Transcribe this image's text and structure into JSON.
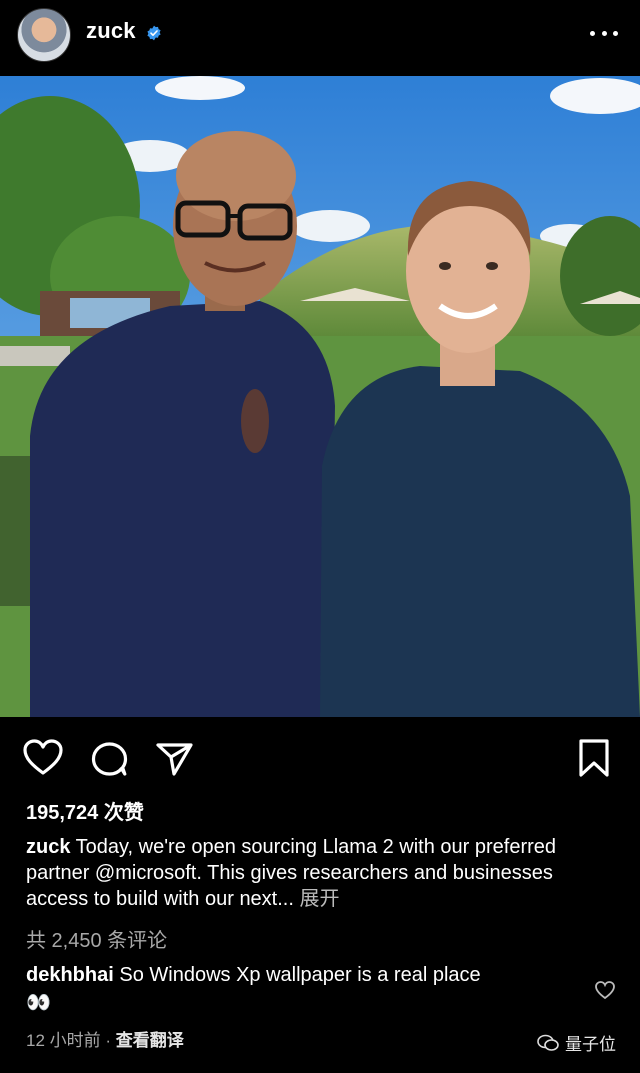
{
  "header": {
    "username": "zuck",
    "verified_icon": "verified-badge-icon",
    "more_icon": "more-options-icon"
  },
  "photo": {
    "icon": "post-photo"
  },
  "actions": {
    "like_icon": "heart-icon",
    "comment_icon": "comment-bubble-icon",
    "share_icon": "send-icon",
    "save_icon": "bookmark-icon"
  },
  "likes": "195,724 次赞",
  "caption": {
    "user": "zuck",
    "text": " Today, we're open sourcing Llama 2 with our preferred partner @microsoft. This gives researchers and businesses access to build with our next...",
    "expand": " 展开"
  },
  "comments_count": "共 2,450 条评论",
  "top_comment": {
    "user": "dekhbhai",
    "text": " So Windows Xp wallpaper is a real place",
    "emoji": "👀"
  },
  "meta": {
    "time": "12 小时前",
    "separator": " · ",
    "translate": "查看翻译"
  },
  "watermark": {
    "text": "量子位"
  },
  "colors": {
    "background": "#000000",
    "verified": "#3897f0",
    "secondary_text": "#a8a8a8"
  }
}
